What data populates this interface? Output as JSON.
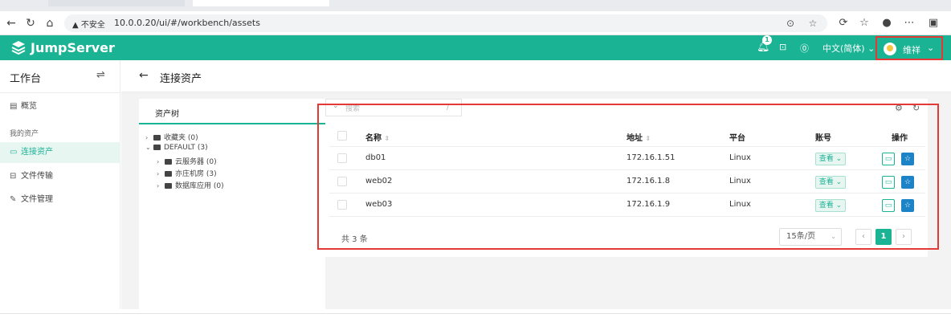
{
  "browser": {
    "url_warning": "▲ 不安全",
    "url": "10.0.0.20/ui/#/workbench/assets"
  },
  "header": {
    "logo_text": "JumpServer",
    "notification_count": "1",
    "language": "中文(简体)",
    "user_name": "维祥",
    "colors": {
      "brand": "#1ab394",
      "highlight": "#e53935"
    }
  },
  "sidebar": {
    "title": "工作台",
    "overview": "概览",
    "group_label": "我的资产",
    "items": [
      {
        "label": "连接资产",
        "icon": "monitor-icon"
      },
      {
        "label": "文件传输",
        "icon": "transfer-icon"
      },
      {
        "label": "文件管理",
        "icon": "edit-icon"
      }
    ]
  },
  "main": {
    "title": "连接资产",
    "tree": {
      "tab_label": "资产树",
      "nodes": [
        {
          "label": "收藏夹 (0)"
        },
        {
          "label": "DEFAULT (3)"
        },
        {
          "label": "云服务器 (0)"
        },
        {
          "label": "亦庄机房 (3)"
        },
        {
          "label": "数据库应用 (0)"
        }
      ]
    },
    "search": {
      "placeholder": "搜索"
    },
    "table": {
      "columns": [
        "名称",
        "地址",
        "平台",
        "账号",
        "操作"
      ],
      "rows": [
        {
          "name": "db01",
          "address": "172.16.1.51",
          "platform": "Linux",
          "account": "查看"
        },
        {
          "name": "web02",
          "address": "172.16.1.8",
          "platform": "Linux",
          "account": "查看"
        },
        {
          "name": "web03",
          "address": "172.16.1.9",
          "platform": "Linux",
          "account": "查看"
        }
      ]
    },
    "footer": {
      "total": "共 3 条",
      "page_size": "15条/页",
      "current_page": "1"
    }
  }
}
